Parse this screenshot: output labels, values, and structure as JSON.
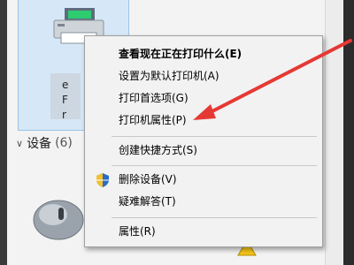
{
  "printer": {
    "name_partial": "e\nF\nr"
  },
  "devices_section": {
    "label": "设备",
    "count": "(6)"
  },
  "context_menu": {
    "items": [
      {
        "label": "查看现在正在打印什么(E)",
        "bold": true
      },
      {
        "label": "设置为默认打印机(A)"
      },
      {
        "label": "打印首选项(G)"
      },
      {
        "label": "打印机属性(P)"
      },
      {
        "label": "创建快捷方式(S)"
      },
      {
        "label": "删除设备(V)"
      },
      {
        "label": "疑难解答(T)"
      },
      {
        "label": "属性(R)"
      }
    ]
  },
  "colors": {
    "annotation_arrow": "#e53935",
    "selection": "#d6e8f7"
  },
  "icons": [
    "printer-icon",
    "shield-icon",
    "mouse-icon",
    "chevron-down-icon",
    "warning-icon"
  ]
}
